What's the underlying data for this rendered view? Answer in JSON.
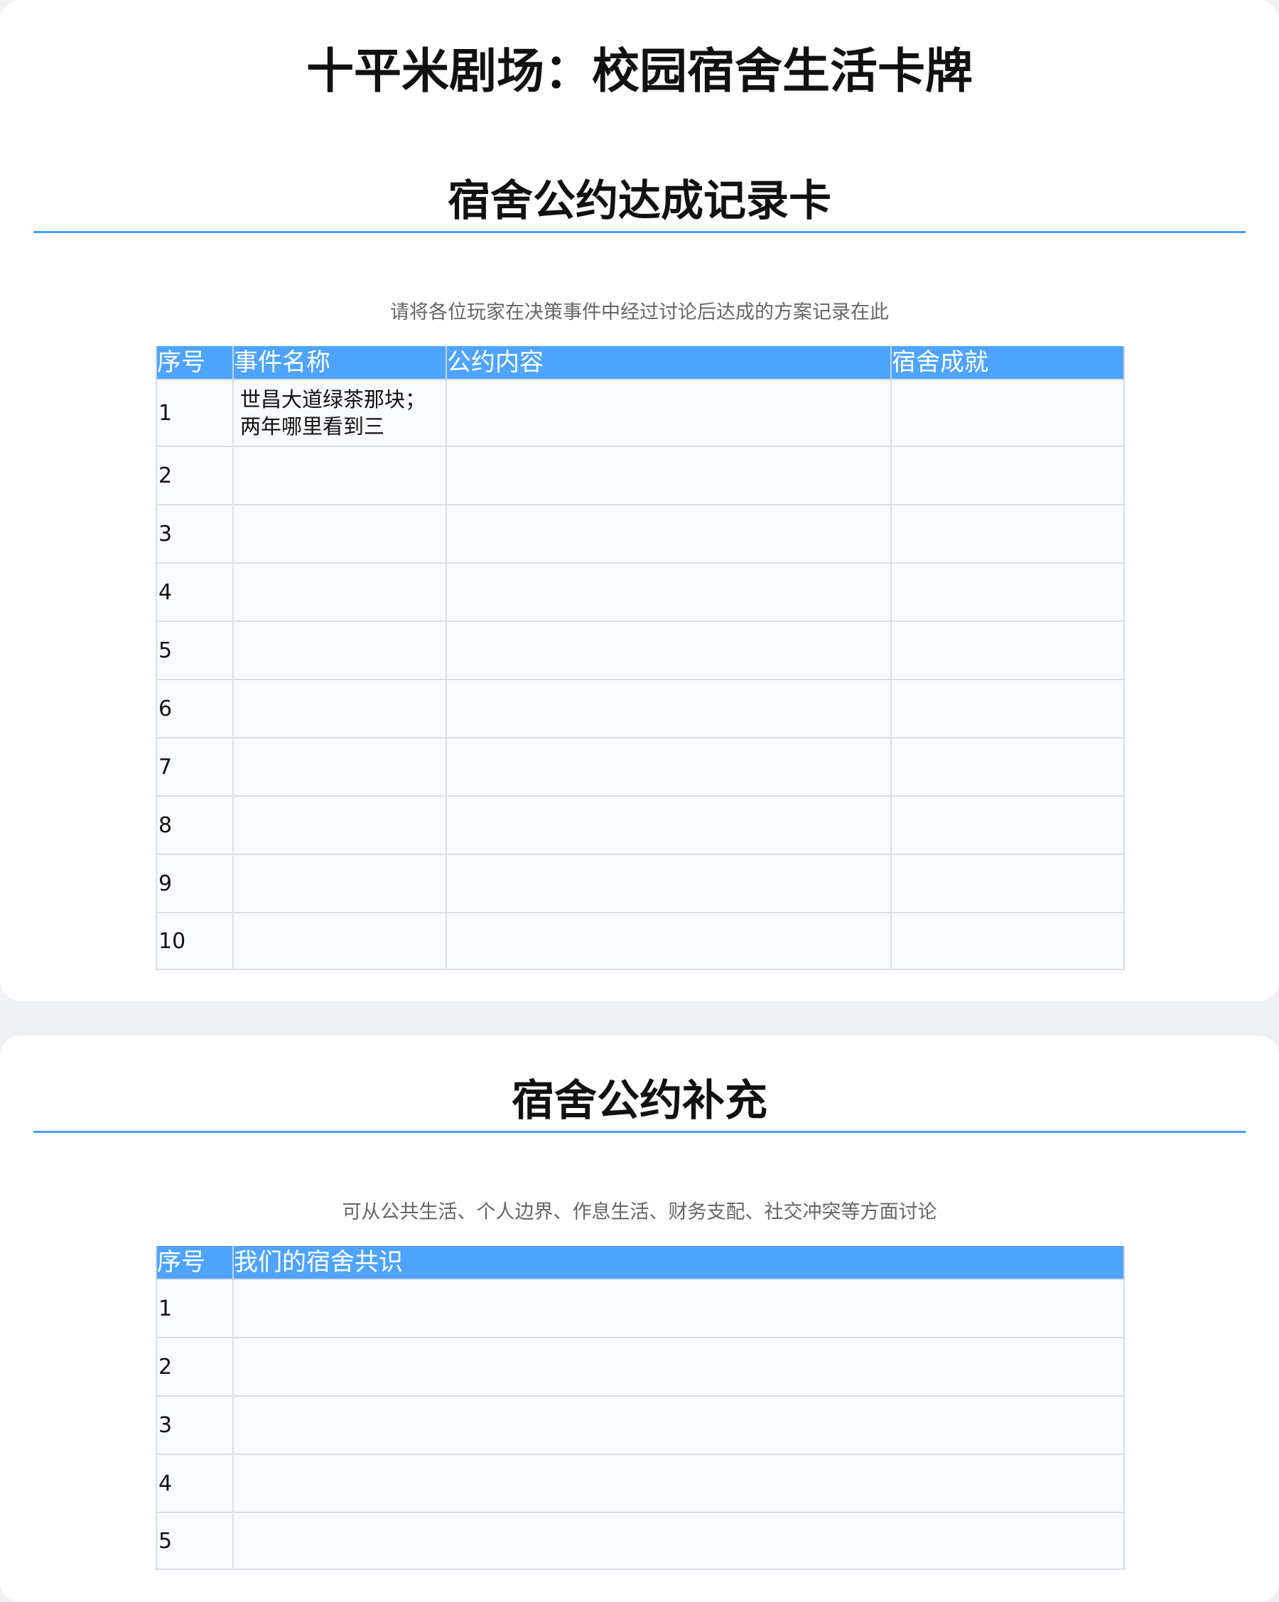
{
  "page": {
    "main_title": "十平米剧场：校园宿舍生活卡牌"
  },
  "section1": {
    "title": "宿舍公约达成记录卡",
    "subtitle": "请将各位玩家在决策事件中经过讨论后达成的方案记录在此",
    "headers": [
      "序号",
      "事件名称",
      "公约内容",
      "宿舍成就"
    ],
    "rows": [
      {
        "no": "1",
        "event": "世昌大道绿茶那块；两年哪里看到三",
        "content": "",
        "achievement": ""
      },
      {
        "no": "2",
        "event": "",
        "content": "",
        "achievement": ""
      },
      {
        "no": "3",
        "event": "",
        "content": "",
        "achievement": ""
      },
      {
        "no": "4",
        "event": "",
        "content": "",
        "achievement": ""
      },
      {
        "no": "5",
        "event": "",
        "content": "",
        "achievement": ""
      },
      {
        "no": "6",
        "event": "",
        "content": "",
        "achievement": ""
      },
      {
        "no": "7",
        "event": "",
        "content": "",
        "achievement": ""
      },
      {
        "no": "8",
        "event": "",
        "content": "",
        "achievement": ""
      },
      {
        "no": "9",
        "event": "",
        "content": "",
        "achievement": ""
      },
      {
        "no": "10",
        "event": "",
        "content": "",
        "achievement": ""
      }
    ]
  },
  "section2": {
    "title": "宿舍公约补充",
    "subtitle": "可从公共生活、个人边界、作息生活、财务支配、社交冲突等方面讨论",
    "headers": [
      "序号",
      "我们的宿舍共识"
    ],
    "rows": [
      {
        "no": "1",
        "consensus": ""
      },
      {
        "no": "2",
        "consensus": ""
      },
      {
        "no": "3",
        "consensus": ""
      },
      {
        "no": "4",
        "consensus": ""
      },
      {
        "no": "5",
        "consensus": ""
      }
    ]
  },
  "colors": {
    "header_blue": "#4ea4ff",
    "accent_line": "#4c9ff2",
    "page_bg": "#eef0f3",
    "card_bg": "#ffffff"
  }
}
